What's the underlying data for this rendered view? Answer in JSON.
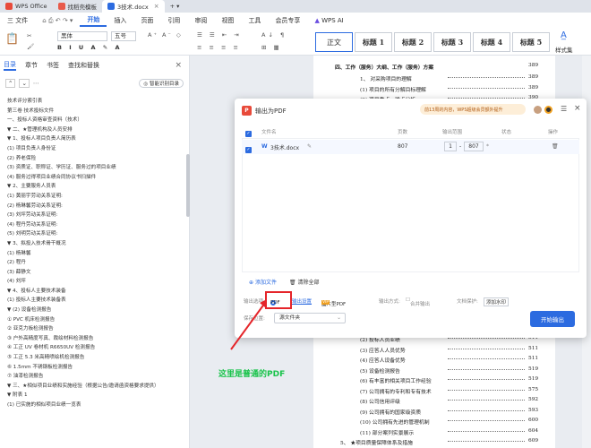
{
  "titlebar": {
    "tabs": [
      {
        "label": "WPS Office",
        "icon": "wps-logo-icon"
      },
      {
        "label": "找稻壳模板",
        "icon": "docer-icon"
      },
      {
        "label": "3技术.docx",
        "icon": "word-doc-icon",
        "active": true
      }
    ]
  },
  "menubar": {
    "file": "三 文件",
    "items": [
      "开始",
      "插入",
      "页面",
      "引用",
      "审阅",
      "视图",
      "工具",
      "会员专享"
    ],
    "ai": "WPS AI"
  },
  "ribbon": {
    "font_name": "黑体",
    "font_size": "五号",
    "styles": [
      "正文",
      "标题 1",
      "标题 2",
      "标题 3",
      "标题 4",
      "标题 5"
    ],
    "style_set": "样式集"
  },
  "leftpane": {
    "tabs": [
      "目录",
      "章节",
      "书签",
      "查找和替换"
    ],
    "smart_toc": "智能识别目录",
    "toc": [
      "技术评分索引表",
      "第三卷    技术投标文件",
      "一、投标人资格审查资料（技术）",
      "▼ 二、★管理机构及人员安排",
      "  ▼ 1、投标人项目负责人简历表",
      "      (1) 项目负责人身份证",
      "      (2) 养老保险",
      "      (3) 资质证、职称证、学历证、服务过的项目业绩",
      "      (4) 服务过得项目业绩合同协议书扫描件",
      "  ▼ 2、主要服务人员表",
      "      (1) 黄丽宇劳动关系证明:",
      "      (2) 杨琳馨劳动关系证明:",
      "      (3) 刘坪劳动关系证明:",
      "      (4) 程丹劳动关系证明:",
      "      (5) 刘明劳动关系证明:",
      "  ▼ 3、拟投入技术骨干概况",
      "      (1) 杨琳馨",
      "      (2) 程丹",
      "      (3) 薛静文",
      "      (4) 刘坪",
      "  ▼ 4、投标人主要技术装备",
      "      (1) 投标人主要技术装备表",
      "    ▼ (2) 设备检测报告",
      "        ① PVC 机床检测报告",
      "        ② 亚克力板检测报告",
      "        ③ 户外高精度写真、裁绘材料检测报告",
      "        ④ 工正 UV 卷材机 R6650UV 检测报告",
      "        ⑤ 工正 5.3 米高精喷绘机检测报告",
      "        ⑥ 1.5mm 不锈钢板检测报告",
      "        ⑦ 油漆检测报告",
      "▼ 三、★相似项目业绩和实施经验（根据公告/邀请函资格要求提供）",
      "  ▼ 附表 1",
      "      (1) 已实施的相似项目业绩一览表"
    ]
  },
  "document": {
    "heading": "四、工作（服务）大纲、工作（服务）方案",
    "heading_page": "389",
    "top_lines": [
      {
        "text": "1、    对采购项目的理解",
        "page": "389"
      },
      {
        "text": "(1)   项目的所有分解目标理解",
        "page": "389"
      },
      {
        "text": "(2)   项目重点、难点分析",
        "page": "390"
      }
    ],
    "bottom_lines": [
      {
        "text": "(2)   投标人员业绩",
        "page": "511"
      },
      {
        "text": "(3)   应答人人员优势",
        "page": "511"
      },
      {
        "text": "(4)   应答人设备优势",
        "page": "511"
      },
      {
        "text": "(5)   设备检测报告",
        "page": "519"
      },
      {
        "text": "(6)   有丰富的相关项目工作经验",
        "page": "519"
      },
      {
        "text": "(7)   公司拥有的专利和专有技术",
        "page": "575"
      },
      {
        "text": "(8)   公司信用评级",
        "page": "592"
      },
      {
        "text": "(9)   公司拥有的国家级资质",
        "page": "593"
      },
      {
        "text": "(10)  公司拥有先进的管理机制",
        "page": "600"
      },
      {
        "text": "(11)  部分案列实景展示",
        "page": "604"
      },
      {
        "text": "5、 ★项目质量保障体系及措施",
        "page": "609"
      }
    ]
  },
  "dialog": {
    "title": "输出为PDF",
    "promo": "前13周的内容，WPS超级会员额外提升",
    "columns": [
      "文件名",
      "页数",
      "输出范围",
      "状态",
      "操作"
    ],
    "file": {
      "name": "3技术.docx",
      "pages": "807",
      "range_from": "1",
      "range_to": "807",
      "range_sep": "-"
    },
    "add_file": "添加文件",
    "clear_all": "清除全部",
    "options": {
      "output_option_label": "输出选项:",
      "pdf": "PDF",
      "output_settings": "输出设置",
      "image_pdf": "图片型PDF",
      "output_method_label": "输出方式:",
      "merge": "合并输出",
      "protection_label": "文档保护:",
      "add_watermark": "添加水印"
    },
    "save_dir_label": "保存位置:",
    "save_dir": "源文件夹",
    "start_button": "开始输出"
  },
  "annotation": {
    "text": "这里是普通的PDF",
    "color": "#18c34a",
    "box_color": "#e5252a"
  },
  "colors": {
    "accent": "#2c6be0",
    "pdf_red": "#e84a3a"
  }
}
